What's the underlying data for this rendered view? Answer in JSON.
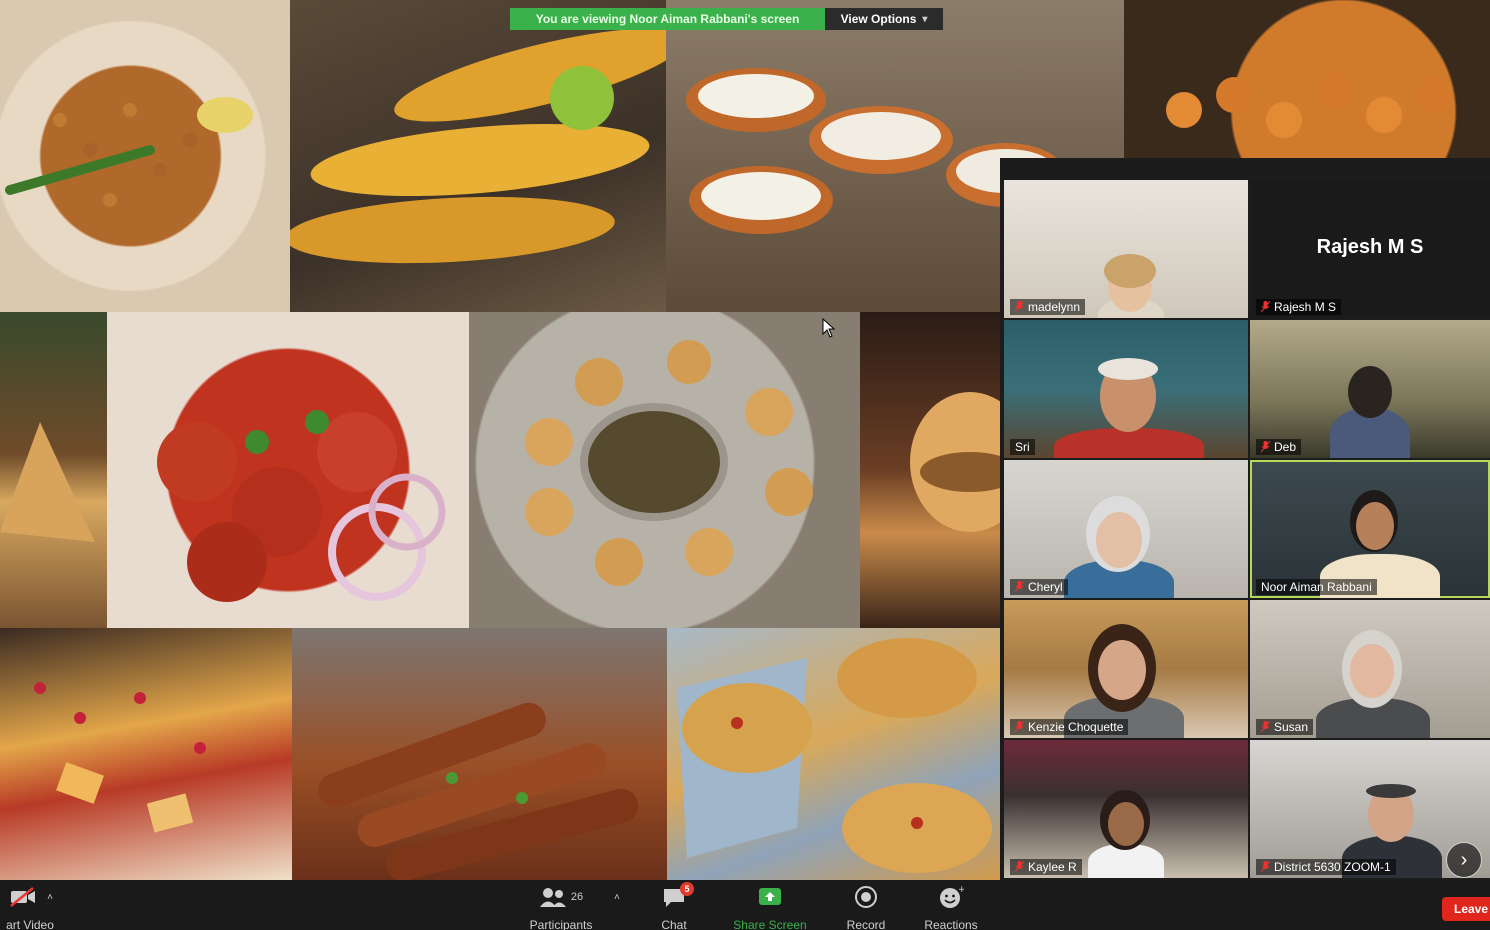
{
  "share": {
    "viewing_banner": "You are viewing Noor Aiman Rabbani's screen",
    "view_options_label": "View Options"
  },
  "gallery": {
    "participants": [
      {
        "name": "madelynn",
        "video": true
      },
      {
        "name": "Rajesh M S",
        "video": false,
        "display_name": "Rajesh M S"
      },
      {
        "name": "Sri",
        "video": true
      },
      {
        "name": "Deb",
        "video": true
      },
      {
        "name": "Cheryl",
        "video": true
      },
      {
        "name": "Noor Aiman Rabbani",
        "video": true,
        "active_speaker": true
      },
      {
        "name": "Kenzie Choquette",
        "video": true
      },
      {
        "name": "Susan",
        "video": true
      },
      {
        "name": "Kaylee R",
        "video": true
      },
      {
        "name": "District 5630 ZOOM-1",
        "video": true
      }
    ]
  },
  "toolbar": {
    "start_video_label": "art Video",
    "participants_label": "Participants",
    "participants_count": "26",
    "chat_label": "Chat",
    "chat_badge": "5",
    "share_screen_label": "Share Screen",
    "record_label": "Record",
    "reactions_label": "Reactions",
    "leave_label": "Leave"
  },
  "colors": {
    "share_green": "#3ab14a",
    "leave_red": "#e0261d",
    "active_speaker": "#b6d95a"
  }
}
